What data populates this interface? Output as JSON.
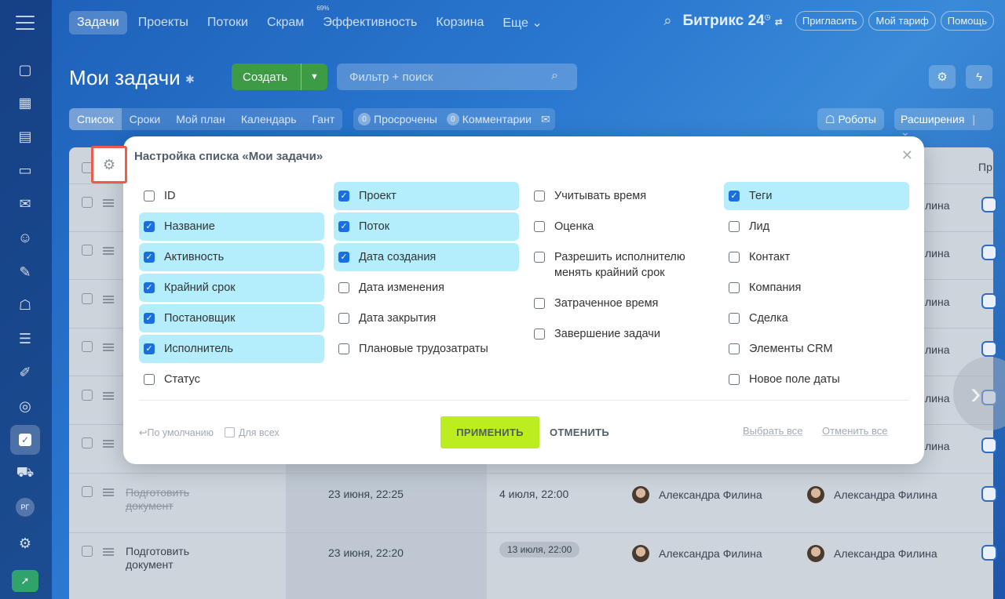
{
  "topnav": {
    "items": [
      {
        "label": "Задачи"
      },
      {
        "label": "Проекты"
      },
      {
        "label": "Потоки"
      },
      {
        "label": "Скрам"
      },
      {
        "label": "Эффективность",
        "badge": "69%"
      },
      {
        "label": "Корзина"
      },
      {
        "label": "Еще ⌄"
      }
    ],
    "brand": "Битрикс 24",
    "invite": "Пригласить",
    "tariff": "Мой тариф",
    "help": "Помощь"
  },
  "header": {
    "title": "Мои задачи",
    "create": "Создать",
    "filter_placeholder": "Фильтр + поиск"
  },
  "views": [
    {
      "label": "Список"
    },
    {
      "label": "Сроки"
    },
    {
      "label": "Мой план"
    },
    {
      "label": "Календарь"
    },
    {
      "label": "Гант"
    }
  ],
  "counters": {
    "overdue": {
      "count": "0",
      "label": "Просрочены"
    },
    "comments": {
      "count": "0",
      "label": "Комментарии"
    }
  },
  "robots": "Роботы",
  "extensions": "Расширения",
  "sidebar": {
    "avatar_initials": "РГ"
  },
  "table": {
    "header_partial": "Пр",
    "side_names": [
      "лина",
      "лина",
      "лина",
      "лина",
      "лина",
      "лина"
    ],
    "rows": [
      {
        "title": "Подготовить документ",
        "strikethrough": true,
        "created": "23 июня, 22:25",
        "deadline": "4 июля, 22:00",
        "deadline_tag": false,
        "responsible": "Александра Филина",
        "owner": "Александра Филина"
      },
      {
        "title": "Подготовить документ",
        "strikethrough": false,
        "created": "23 июня, 22:20",
        "deadline": "13 июля, 22:00",
        "deadline_tag": true,
        "responsible": "Александра Филина",
        "owner": "Александра Филина"
      }
    ]
  },
  "modal": {
    "title": "Настройка списка «Мои задачи»",
    "columns": [
      [
        {
          "label": "ID",
          "checked": false
        },
        {
          "label": "Название",
          "checked": true
        },
        {
          "label": "Активность",
          "checked": true
        },
        {
          "label": "Крайний срок",
          "checked": true
        },
        {
          "label": "Постановщик",
          "checked": true
        },
        {
          "label": "Исполнитель",
          "checked": true
        },
        {
          "label": "Статус",
          "checked": false
        }
      ],
      [
        {
          "label": "Проект",
          "checked": true
        },
        {
          "label": "Поток",
          "checked": true
        },
        {
          "label": "Дата создания",
          "checked": true
        },
        {
          "label": "Дата изменения",
          "checked": false
        },
        {
          "label": "Дата закрытия",
          "checked": false
        },
        {
          "label": "Плановые трудозатраты",
          "checked": false
        }
      ],
      [
        {
          "label": "Учитывать время",
          "checked": false
        },
        {
          "label": "Оценка",
          "checked": false
        },
        {
          "label": "Разрешить исполнителю менять крайний срок",
          "checked": false
        },
        {
          "label": "Затраченное время",
          "checked": false
        },
        {
          "label": "Завершение задачи",
          "checked": false
        }
      ],
      [
        {
          "label": "Теги",
          "checked": true
        },
        {
          "label": "Лид",
          "checked": false
        },
        {
          "label": "Контакт",
          "checked": false
        },
        {
          "label": "Компания",
          "checked": false
        },
        {
          "label": "Сделка",
          "checked": false
        },
        {
          "label": "Элементы CRM",
          "checked": false
        },
        {
          "label": "Новое поле даты",
          "checked": false
        }
      ]
    ],
    "default_label": "По умолчанию",
    "for_all_label": "Для всех",
    "apply": "ПРИМЕНИТЬ",
    "cancel": "ОТМЕНИТЬ",
    "select_all": "Выбрать все",
    "deselect_all": "Отменить все"
  },
  "colors": {
    "checked_bg": "#b4eefc",
    "checkbox_blue": "#1a6fe0",
    "apply_btn": "#bbed21",
    "create_btn": "#3d9b45",
    "highlight_red": "#f05a4a"
  }
}
